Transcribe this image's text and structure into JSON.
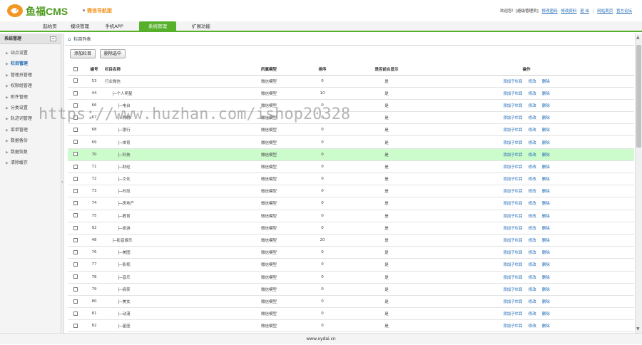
{
  "app": {
    "logo_text": "鱼福CMS",
    "logo_subtitle": "微信导航版",
    "welcome_text": "欢迎您！[超级管理员]",
    "top_links": [
      "修改密码",
      "修改资料",
      "退 出",
      "网站首页",
      "官方论坛"
    ],
    "accent_color": "#56b02c",
    "logo_color": "#f29624"
  },
  "nav": {
    "tabs": [
      "起始页",
      "模块管理",
      "手机APP",
      "系统管理",
      "扩展功能"
    ],
    "active_tab": "系统管理"
  },
  "sidebar": {
    "title": "系统管理",
    "collapse_icon": "minus-icon",
    "items": [
      "站点设置",
      "栏目管理",
      "管理员管理",
      "权限组管理",
      "附件管理",
      "分类设置",
      "轨迹词管理",
      "菜单管理",
      "数据备份",
      "数据恢复",
      "清除缓存"
    ],
    "active_item": "栏目管理"
  },
  "main": {
    "breadcrumb": "栏目列表",
    "buttons": {
      "add": "添加栏目",
      "delete_selected": "删除选中"
    },
    "columns": {
      "id": "编号",
      "name": "栏目名称",
      "model": "所属模型",
      "order": "排序",
      "show": "是否前台显示",
      "ops": "操作"
    },
    "op_labels": {
      "add_child": "添加子栏目",
      "edit": "修改",
      "delete": "删除"
    },
    "rows": [
      {
        "id": "53",
        "name": "行业微信",
        "model": "微信模型",
        "order": "0",
        "show": "是",
        "level": 0
      },
      {
        "id": "44",
        "name": "├─个人明星",
        "model": "微信模型",
        "order": "10",
        "show": "是",
        "level": 1
      },
      {
        "id": "66",
        "name": "├─电台",
        "model": "微信模型",
        "order": "0",
        "show": "是",
        "level": 2
      },
      {
        "id": "67",
        "name": "├─购物",
        "model": "微信模型",
        "order": "0",
        "show": "是",
        "level": 2
      },
      {
        "id": "68",
        "name": "├─银行",
        "model": "微信模型",
        "order": "0",
        "show": "是",
        "level": 2
      },
      {
        "id": "69",
        "name": "├─体育",
        "model": "微信模型",
        "order": "0",
        "show": "是",
        "level": 2
      },
      {
        "id": "70",
        "name": "├─科技",
        "model": "微信模型",
        "order": "0",
        "show": "是",
        "level": 2
      },
      {
        "id": "71",
        "name": "├─财经",
        "model": "微信模型",
        "order": "0",
        "show": "是",
        "level": 2
      },
      {
        "id": "72",
        "name": "├─文化",
        "model": "微信模型",
        "order": "0",
        "show": "是",
        "level": 2
      },
      {
        "id": "73",
        "name": "├─时尚",
        "model": "微信模型",
        "order": "0",
        "show": "是",
        "level": 2
      },
      {
        "id": "74",
        "name": "├─房地产",
        "model": "微信模型",
        "order": "0",
        "show": "是",
        "level": 2
      },
      {
        "id": "75",
        "name": "├─教育",
        "model": "微信模型",
        "order": "0",
        "show": "是",
        "level": 2
      },
      {
        "id": "92",
        "name": "├─旅游",
        "model": "微信模型",
        "order": "0",
        "show": "是",
        "level": 2
      },
      {
        "id": "48",
        "name": "├─影音娱乐",
        "model": "微信模型",
        "order": "20",
        "show": "是",
        "level": 1
      },
      {
        "id": "76",
        "name": "├─美图",
        "model": "微信模型",
        "order": "0",
        "show": "是",
        "level": 2
      },
      {
        "id": "77",
        "name": "├─影视",
        "model": "微信模型",
        "order": "0",
        "show": "是",
        "level": 2
      },
      {
        "id": "78",
        "name": "├─音乐",
        "model": "微信模型",
        "order": "0",
        "show": "是",
        "level": 2
      },
      {
        "id": "79",
        "name": "├─搞笑",
        "model": "微信模型",
        "order": "0",
        "show": "是",
        "level": 2
      },
      {
        "id": "80",
        "name": "├─美女",
        "model": "微信模型",
        "order": "0",
        "show": "是",
        "level": 2
      },
      {
        "id": "81",
        "name": "├─动漫",
        "model": "微信模型",
        "order": "0",
        "show": "是",
        "level": 2
      },
      {
        "id": "82",
        "name": "├─星座",
        "model": "微信模型",
        "order": "0",
        "show": "是",
        "level": 2
      }
    ],
    "highlighted_row_id": "70"
  },
  "footer": {
    "text": "www.xydai.cn"
  },
  "watermark": "https://www.huzhan.com/ishop20328"
}
